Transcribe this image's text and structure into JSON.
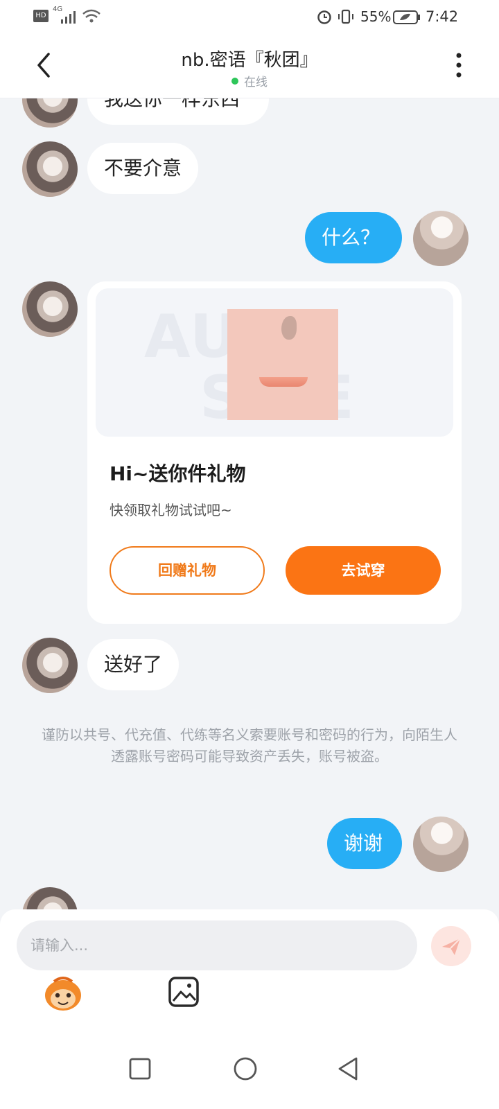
{
  "status_bar": {
    "network": "4G",
    "battery": "55%",
    "time": "7:42"
  },
  "header": {
    "title": "nb.密语『秋团』",
    "status": "在线"
  },
  "messages": [
    {
      "side": "in",
      "text": "我送你一样东西"
    },
    {
      "side": "in",
      "text": "不要介意"
    },
    {
      "side": "out",
      "text": "什么？"
    },
    {
      "side": "in",
      "text": "送好了"
    },
    {
      "side": "out",
      "text": "谢谢"
    }
  ],
  "gift_card": {
    "watermark_top": "AU  R",
    "watermark_bottom": "S    RE",
    "title": "Hi~送你件礼物",
    "subtitle": "快领取礼物试试吧~",
    "return_label": "回赠礼物",
    "tryon_label": "去试穿"
  },
  "notice": "谨防以共号、代充值、代练等名义索要账号和密码的行为，向陌生人透露账号密码可能导致资产丢失，账号被盗。",
  "input": {
    "placeholder": "请输入..."
  },
  "toolbar": {
    "emoji_icon": "monkey-face-icon",
    "image_icon": "image-icon"
  },
  "nav": {
    "recent": "square-icon",
    "home": "circle-icon",
    "back": "triangle-icon"
  },
  "colors": {
    "accent_blue": "#27aef5",
    "gift_orange": "#fb7414",
    "online_green": "#2ec65a"
  }
}
